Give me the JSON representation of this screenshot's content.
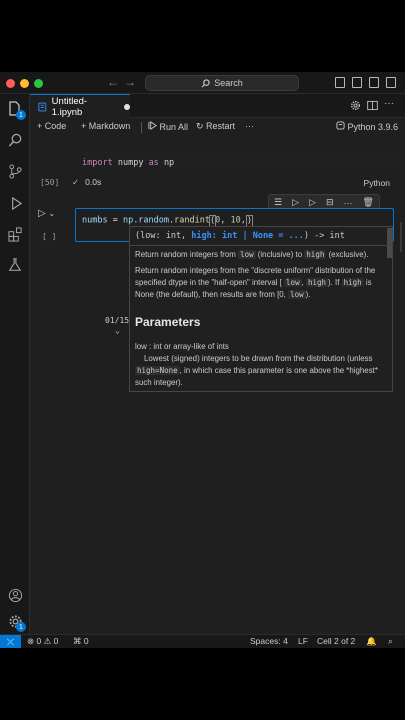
{
  "titlebar": {
    "search_label": "Search"
  },
  "tab": {
    "title": "Untitled-1.ipynb"
  },
  "toolbar": {
    "code_label": "Code",
    "markdown_label": "Markdown",
    "run_all_label": "Run All",
    "restart_label": "Restart",
    "more_label": "···",
    "kernel_label": "Python 3.9.6"
  },
  "cell1": {
    "code_kw1": "import",
    "code_mod": "numpy",
    "code_kw2": "as",
    "code_alias": "np",
    "exec_count": "[50]",
    "duration": "0.0s",
    "language": "Python"
  },
  "cell2": {
    "var": "numbs",
    "eq": " = ",
    "call": "np.random.",
    "func": "randint",
    "arg1": "0",
    "sepr": ", ",
    "arg2": "10",
    "comma": ",",
    "exec_placeholder": "[ ]"
  },
  "hover": {
    "sig_open": "(low: int, ",
    "sig_active": "high: int | None = ...",
    "sig_close": ") -> int",
    "line1_a": "Return random integers from ",
    "line1_low": "low",
    "line1_b": " (inclusive) to ",
    "line1_high": "high",
    "line1_c": " (exclusive).",
    "p2_a": "Return random integers from the \"discrete uniform\" distribution of the specified dtype in the \"half-open\" interval [",
    "p2_low": "low",
    "p2_b": ", ",
    "p2_high": "high",
    "p2_c": "). If ",
    "p2_high2": "high",
    "p2_d": " is None (the default), then results are from [0, ",
    "p2_low2": "low",
    "p2_e": ").",
    "params_heading": "Parameters",
    "param1_name": "low : int or array-like of ints",
    "param1_a": "Lowest (signed) integers to be drawn from the distribution (unless ",
    "param1_code": "high=None",
    "param1_b": ", in which case this parameter is one above the *highest* such integer).",
    "counter": "01/15"
  },
  "statusbar": {
    "errors": "0",
    "warnings": "0",
    "ports": "0",
    "spaces": "Spaces: 4",
    "eol": "LF",
    "cell": "Cell 2 of 2"
  }
}
